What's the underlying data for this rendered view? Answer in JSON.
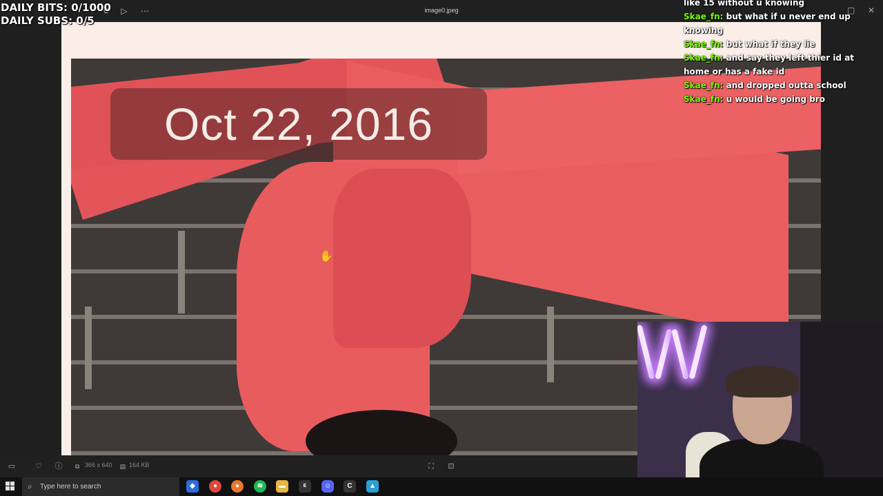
{
  "overlay": {
    "bits": "DAILY BITS: 0/1000",
    "subs": "DAILY SUBS: 0/5"
  },
  "viewer": {
    "filename": "image0.jpeg",
    "photo_date_label": "Oct 22, 2016",
    "dimensions": "366 x 640",
    "file_size": "164 KB"
  },
  "chat": [
    {
      "user": "",
      "text": "like 15 without u knowing"
    },
    {
      "user": "Skae_fn:",
      "text": "but what if u never end up knowing"
    },
    {
      "user": "Skae_fn:",
      "text": "but what if they lie"
    },
    {
      "user": "Skae_fn:",
      "text": "and say they left thier id at home or has a fake id"
    },
    {
      "user": "Skae_fn:",
      "text": "and dropped outta school"
    },
    {
      "user": "Skae_fn:",
      "text": "u would be going bro"
    }
  ],
  "taskbar": {
    "search_placeholder": "Type here to search"
  },
  "colors": {
    "chat_user": "#7CFC00",
    "drape": "#e85a5c",
    "app_bg": "#1f1f1f"
  }
}
